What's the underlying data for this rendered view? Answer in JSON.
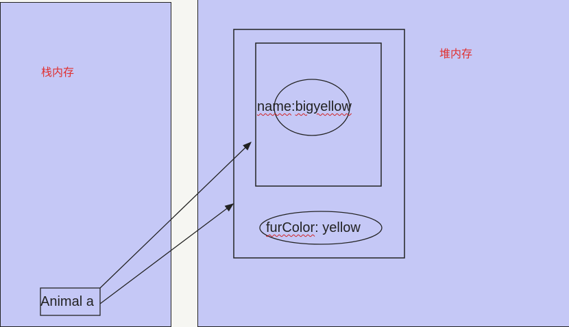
{
  "stack": {
    "title": "栈内存",
    "var_label": "Animal a"
  },
  "heap": {
    "title": "堆内存",
    "name_field": {
      "key": "name",
      "sep": ":",
      "value": "bigyellow"
    },
    "fur_field": {
      "key": "furColor",
      "sep": ": ",
      "value": "yellow"
    }
  },
  "colors": {
    "panel": "#c5c8f6",
    "label": "#e03030",
    "stroke": "#222222"
  }
}
